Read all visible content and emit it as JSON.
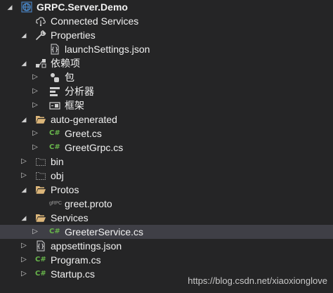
{
  "tree": {
    "project": {
      "label": "GRPC.Server.Demo"
    },
    "connected_services": {
      "label": "Connected Services"
    },
    "properties": {
      "label": "Properties"
    },
    "launch_settings": {
      "label": "launchSettings.json"
    },
    "dependencies": {
      "label": "依赖项"
    },
    "packages": {
      "label": "包"
    },
    "analyzers": {
      "label": "分析器"
    },
    "frameworks": {
      "label": "框架"
    },
    "auto_generated": {
      "label": "auto-generated"
    },
    "greet_cs": {
      "label": "Greet.cs"
    },
    "greet_grpc_cs": {
      "label": "GreetGrpc.cs"
    },
    "bin": {
      "label": "bin"
    },
    "obj": {
      "label": "obj"
    },
    "protos": {
      "label": "Protos"
    },
    "greet_proto": {
      "label": "greet.proto",
      "icon_text": "gRPC"
    },
    "services": {
      "label": "Services"
    },
    "greeter_service": {
      "label": "GreeterService.cs"
    },
    "appsettings": {
      "label": "appsettings.json"
    },
    "program": {
      "label": "Program.cs"
    },
    "startup": {
      "label": "Startup.cs"
    }
  },
  "icons": {
    "cs_text": "C#"
  },
  "watermark": "https://blog.csdn.net/xiaoxionglove",
  "colors": {
    "background": "#252526",
    "selected_row": "#3f3f46",
    "folder": "#dcb67a",
    "csharp": "#68b54b",
    "globe": "#4a90d9"
  }
}
